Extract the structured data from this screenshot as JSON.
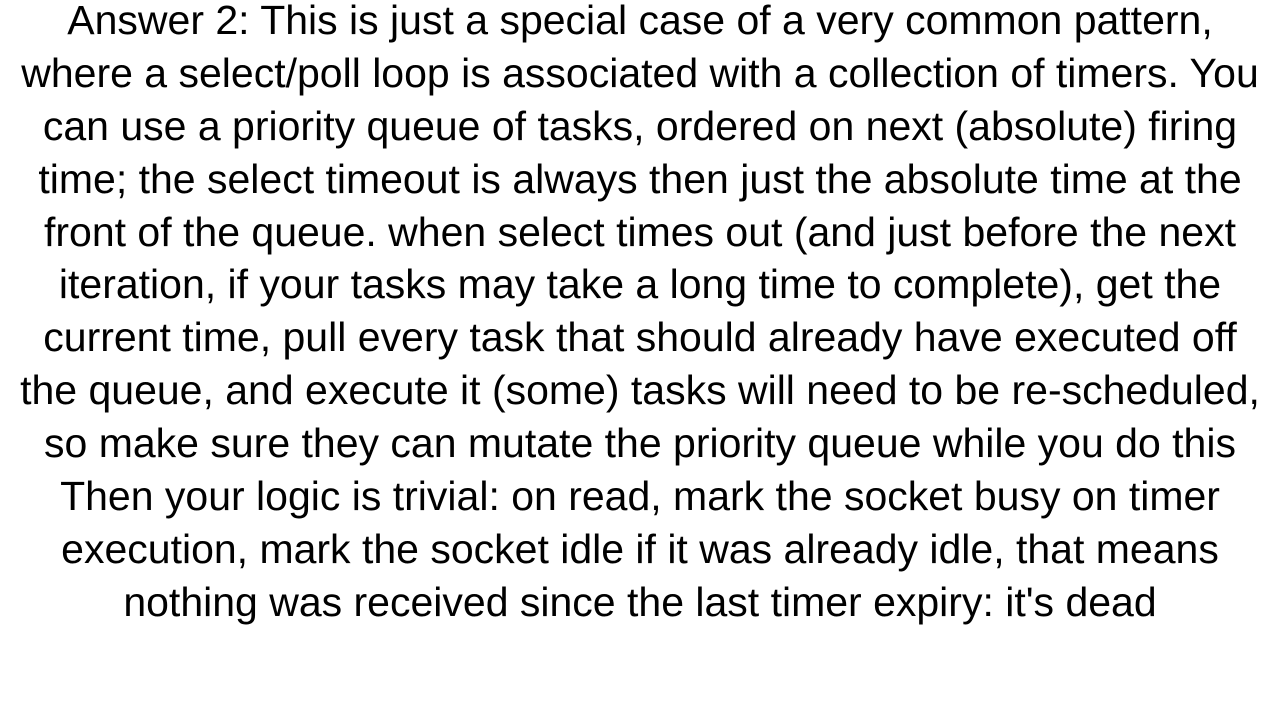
{
  "answer": {
    "text": "Answer 2: This is just a special case of a very common pattern, where a select/poll loop is associated with a collection of timers. You can use a priority queue of tasks, ordered on next (absolute) firing time; the select timeout is always then just the absolute time at the front of the queue.  when select times out (and just before the next iteration, if your tasks may take a long time to complete), get the current time, pull every task that should already have executed off the queue, and execute it (some) tasks will need to be re-scheduled, so make sure they can mutate the priority queue while you do this  Then your logic is trivial:  on read, mark the socket busy on timer execution, mark the socket idle  if it was already idle, that means nothing was received since the last timer expiry: it's dead"
  }
}
